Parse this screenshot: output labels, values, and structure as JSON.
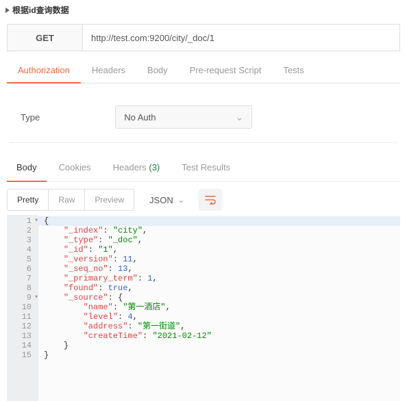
{
  "panel_title": "根据id查询数据",
  "request": {
    "method": "GET",
    "url": "http://test.com:9200/city/_doc/1"
  },
  "tabs": {
    "authorization": "Authorization",
    "headers": "Headers",
    "body": "Body",
    "pre_request": "Pre-request Script",
    "tests": "Tests",
    "active": "authorization"
  },
  "auth": {
    "type_label": "Type",
    "selected": "No Auth"
  },
  "response_tabs": {
    "body": "Body",
    "cookies": "Cookies",
    "headers": "Headers",
    "headers_count": "(3)",
    "test_results": "Test Results",
    "active": "body"
  },
  "view": {
    "pretty": "Pretty",
    "raw": "Raw",
    "preview": "Preview",
    "format": "JSON"
  },
  "chart_data": {
    "type": "table",
    "note": "JSON response body",
    "body": {
      "_index": "city",
      "_type": "_doc",
      "_id": "1",
      "_version": 11,
      "_seq_no": 13,
      "_primary_term": 1,
      "found": true,
      "_source": {
        "name": "第一酒店",
        "level": 4,
        "address": "第一街道",
        "createTime": "2021-02-12"
      }
    }
  },
  "code_lines": [
    {
      "n": 1,
      "fold": true,
      "indent": 0,
      "type": "raw",
      "text": "{"
    },
    {
      "n": 2,
      "indent": 1,
      "type": "kv",
      "key": "_index",
      "val": "city",
      "vt": "s",
      "comma": true
    },
    {
      "n": 3,
      "indent": 1,
      "type": "kv",
      "key": "_type",
      "val": "_doc",
      "vt": "s",
      "comma": true
    },
    {
      "n": 4,
      "indent": 1,
      "type": "kv",
      "key": "_id",
      "val": "1",
      "vt": "s",
      "comma": true
    },
    {
      "n": 5,
      "indent": 1,
      "type": "kv",
      "key": "_version",
      "val": "11",
      "vt": "n",
      "comma": true
    },
    {
      "n": 6,
      "indent": 1,
      "type": "kv",
      "key": "_seq_no",
      "val": "13",
      "vt": "n",
      "comma": true
    },
    {
      "n": 7,
      "indent": 1,
      "type": "kv",
      "key": "_primary_term",
      "val": "1",
      "vt": "n",
      "comma": true
    },
    {
      "n": 8,
      "indent": 1,
      "type": "kv",
      "key": "found",
      "val": "true",
      "vt": "b",
      "comma": true
    },
    {
      "n": 9,
      "fold": true,
      "indent": 1,
      "type": "ko",
      "key": "_source"
    },
    {
      "n": 10,
      "indent": 2,
      "type": "kv",
      "key": "name",
      "val": "第一酒店",
      "vt": "s",
      "comma": true
    },
    {
      "n": 11,
      "indent": 2,
      "type": "kv",
      "key": "level",
      "val": "4",
      "vt": "n",
      "comma": true
    },
    {
      "n": 12,
      "indent": 2,
      "type": "kv",
      "key": "address",
      "val": "第一街道",
      "vt": "s",
      "comma": true
    },
    {
      "n": 13,
      "indent": 2,
      "type": "kv",
      "key": "createTime",
      "val": "2021-02-12",
      "vt": "s",
      "comma": false
    },
    {
      "n": 14,
      "indent": 1,
      "type": "raw",
      "text": "}"
    },
    {
      "n": 15,
      "indent": 0,
      "type": "raw",
      "text": "}"
    }
  ]
}
